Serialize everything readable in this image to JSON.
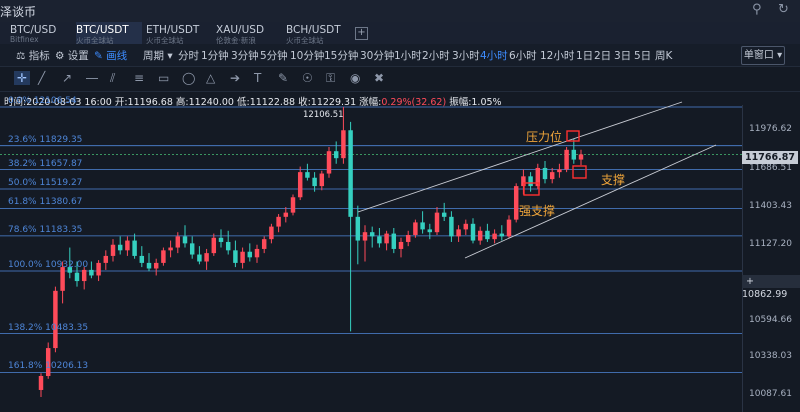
{
  "window": {
    "title": "泽谈币",
    "controls": [
      "search-icon",
      "refresh-icon"
    ]
  },
  "tabs": [
    {
      "name": "BTC/USD",
      "sub": "Bitfinex",
      "active": false
    },
    {
      "name": "BTC/USDT",
      "sub": "火币全球站",
      "active": true
    },
    {
      "name": "ETH/USDT",
      "sub": "火币全球站",
      "active": false
    },
    {
      "name": "XAU/USD",
      "sub": "伦敦金·新浪",
      "active": false
    },
    {
      "name": "BCH/USDT",
      "sub": "火币全球站",
      "active": false
    }
  ],
  "toolbar": {
    "indicator": "指标",
    "settings": "设置",
    "draw": "画线",
    "period": "周期",
    "timeframes": [
      "分时",
      "1分钟",
      "3分钟",
      "5分钟",
      "10分钟",
      "15分钟",
      "30分钟",
      "1小时",
      "2小时",
      "3小时",
      "4小时",
      "6小时",
      "12小时",
      "1日",
      "2日",
      "3日",
      "5日",
      "周K"
    ],
    "active_timeframe": "4小时",
    "new_window": "单窗口"
  },
  "draw_tools": [
    "crosshair-icon",
    "line-icon",
    "ray-icon",
    "horizontal-line-icon",
    "parallel-channel-icon",
    "fibonacci-icon",
    "rectangle-icon",
    "ellipse-icon",
    "triangle-icon",
    "arrow-icon",
    "text-icon",
    "pencil-icon",
    "magnet-icon",
    "lock-icon",
    "eye-icon",
    "trash-icon"
  ],
  "ohlc": {
    "time_label": "时间:",
    "time": "2020-08-03 16:00",
    "open_label": "开:",
    "open": "11196.68",
    "high_label": "高:",
    "high": "11240.00",
    "low_label": "低:",
    "low": "11122.88",
    "close_label": "收:",
    "close": "11229.31",
    "change_label": "涨幅:",
    "change": "0.29%(32.62)",
    "amplitude_label": "振幅:",
    "amplitude": "1.05%"
  },
  "price_axis": [
    "11976.62",
    "11686.51",
    "11403.43",
    "11127.20",
    "10594.66",
    "10338.03",
    "10087.61"
  ],
  "current_price": "11766.87",
  "hover_price": "10862.99",
  "fib_levels": [
    {
      "label": "0.0% 12106.54",
      "price": 12106.54
    },
    {
      "label": "23.6% 11829.35",
      "price": 11829.35
    },
    {
      "label": "38.2% 11657.87",
      "price": 11657.87
    },
    {
      "label": "50.0% 11519.27",
      "price": 11519.27
    },
    {
      "label": "61.8% 11380.67",
      "price": 11380.67
    },
    {
      "label": "78.6% 11183.35",
      "price": 11183.35
    },
    {
      "label": "100.0% 10932.00",
      "price": 10932.0
    },
    {
      "label": "138.2% 10483.35",
      "price": 10483.35
    },
    {
      "label": "161.8% 10206.13",
      "price": 10206.13
    }
  ],
  "peak_label": "12106.51",
  "annotations": {
    "resistance": "压力位",
    "support": "支撑",
    "strong_support": "强支撑"
  },
  "colors": {
    "up": "#ff4b5a",
    "down": "#35d0c0",
    "fib": "#4e86d8",
    "annotation": "#f0a53a",
    "marker": "#ff3030"
  },
  "chart_data": {
    "type": "candlestick",
    "ylim": [
      10030,
      12160
    ],
    "candles": [
      {
        "o": 10080,
        "h": 10200,
        "l": 10030,
        "c": 10180
      },
      {
        "o": 10180,
        "h": 10420,
        "l": 10160,
        "c": 10380
      },
      {
        "o": 10380,
        "h": 10820,
        "l": 10350,
        "c": 10790
      },
      {
        "o": 10790,
        "h": 11000,
        "l": 10700,
        "c": 10960
      },
      {
        "o": 10960,
        "h": 11100,
        "l": 10880,
        "c": 10920
      },
      {
        "o": 10920,
        "h": 11000,
        "l": 10820,
        "c": 10860
      },
      {
        "o": 10860,
        "h": 10960,
        "l": 10800,
        "c": 10940
      },
      {
        "o": 10940,
        "h": 11000,
        "l": 10880,
        "c": 10900
      },
      {
        "o": 10900,
        "h": 11010,
        "l": 10860,
        "c": 10990
      },
      {
        "o": 10990,
        "h": 11080,
        "l": 10940,
        "c": 11040
      },
      {
        "o": 11040,
        "h": 11160,
        "l": 11000,
        "c": 11120
      },
      {
        "o": 11120,
        "h": 11180,
        "l": 11050,
        "c": 11080
      },
      {
        "o": 11080,
        "h": 11180,
        "l": 11040,
        "c": 11150
      },
      {
        "o": 11150,
        "h": 11200,
        "l": 11020,
        "c": 11040
      },
      {
        "o": 11040,
        "h": 11110,
        "l": 10960,
        "c": 10990
      },
      {
        "o": 10990,
        "h": 11060,
        "l": 10930,
        "c": 10950
      },
      {
        "o": 10950,
        "h": 11020,
        "l": 10900,
        "c": 10990
      },
      {
        "o": 10990,
        "h": 11100,
        "l": 10970,
        "c": 11080
      },
      {
        "o": 11080,
        "h": 11150,
        "l": 11030,
        "c": 11100
      },
      {
        "o": 11100,
        "h": 11210,
        "l": 11060,
        "c": 11180
      },
      {
        "o": 11180,
        "h": 11260,
        "l": 11100,
        "c": 11130
      },
      {
        "o": 11130,
        "h": 11180,
        "l": 11020,
        "c": 11050
      },
      {
        "o": 11050,
        "h": 11110,
        "l": 10980,
        "c": 11000
      },
      {
        "o": 11000,
        "h": 11090,
        "l": 10940,
        "c": 11060
      },
      {
        "o": 11060,
        "h": 11200,
        "l": 11040,
        "c": 11170
      },
      {
        "o": 11170,
        "h": 11230,
        "l": 11100,
        "c": 11140
      },
      {
        "o": 11140,
        "h": 11220,
        "l": 11050,
        "c": 11080
      },
      {
        "o": 11080,
        "h": 11150,
        "l": 10960,
        "c": 10990
      },
      {
        "o": 10990,
        "h": 11100,
        "l": 10950,
        "c": 11070
      },
      {
        "o": 11070,
        "h": 11130,
        "l": 11000,
        "c": 11030
      },
      {
        "o": 11030,
        "h": 11120,
        "l": 10990,
        "c": 11090
      },
      {
        "o": 11090,
        "h": 11180,
        "l": 11060,
        "c": 11160
      },
      {
        "o": 11160,
        "h": 11270,
        "l": 11130,
        "c": 11250
      },
      {
        "o": 11250,
        "h": 11340,
        "l": 11210,
        "c": 11320
      },
      {
        "o": 11320,
        "h": 11390,
        "l": 11280,
        "c": 11350
      },
      {
        "o": 11350,
        "h": 11480,
        "l": 11330,
        "c": 11460
      },
      {
        "o": 11460,
        "h": 11680,
        "l": 11440,
        "c": 11640
      },
      {
        "o": 11640,
        "h": 11700,
        "l": 11580,
        "c": 11600
      },
      {
        "o": 11600,
        "h": 11640,
        "l": 11500,
        "c": 11540
      },
      {
        "o": 11540,
        "h": 11650,
        "l": 11510,
        "c": 11630
      },
      {
        "o": 11630,
        "h": 11820,
        "l": 11600,
        "c": 11790
      },
      {
        "o": 11790,
        "h": 11860,
        "l": 11700,
        "c": 11740
      },
      {
        "o": 11740,
        "h": 12106,
        "l": 11700,
        "c": 11940
      },
      {
        "o": 11940,
        "h": 12000,
        "l": 10500,
        "c": 11320
      },
      {
        "o": 11320,
        "h": 11400,
        "l": 10980,
        "c": 11150
      },
      {
        "o": 11150,
        "h": 11260,
        "l": 11000,
        "c": 11210
      },
      {
        "o": 11210,
        "h": 11250,
        "l": 11100,
        "c": 11180
      },
      {
        "o": 11180,
        "h": 11240,
        "l": 11100,
        "c": 11130
      },
      {
        "o": 11130,
        "h": 11220,
        "l": 11080,
        "c": 11200
      },
      {
        "o": 11200,
        "h": 11240,
        "l": 11060,
        "c": 11090
      },
      {
        "o": 11090,
        "h": 11170,
        "l": 11030,
        "c": 11140
      },
      {
        "o": 11140,
        "h": 11220,
        "l": 11110,
        "c": 11190
      },
      {
        "o": 11190,
        "h": 11300,
        "l": 11170,
        "c": 11280
      },
      {
        "o": 11280,
        "h": 11360,
        "l": 11200,
        "c": 11230
      },
      {
        "o": 11230,
        "h": 11270,
        "l": 11160,
        "c": 11210
      },
      {
        "o": 11210,
        "h": 11390,
        "l": 11190,
        "c": 11350
      },
      {
        "o": 11350,
        "h": 11420,
        "l": 11290,
        "c": 11320
      },
      {
        "o": 11320,
        "h": 11360,
        "l": 11140,
        "c": 11180
      },
      {
        "o": 11180,
        "h": 11260,
        "l": 11140,
        "c": 11230
      },
      {
        "o": 11230,
        "h": 11300,
        "l": 11190,
        "c": 11270
      },
      {
        "o": 11270,
        "h": 11310,
        "l": 11130,
        "c": 11150
      },
      {
        "o": 11150,
        "h": 11250,
        "l": 11120,
        "c": 11220
      },
      {
        "o": 11220,
        "h": 11270,
        "l": 11140,
        "c": 11160
      },
      {
        "o": 11160,
        "h": 11230,
        "l": 11130,
        "c": 11200
      },
      {
        "o": 11200,
        "h": 11260,
        "l": 11150,
        "c": 11180
      },
      {
        "o": 11180,
        "h": 11330,
        "l": 11170,
        "c": 11300
      },
      {
        "o": 11300,
        "h": 11560,
        "l": 11280,
        "c": 11540
      },
      {
        "o": 11540,
        "h": 11660,
        "l": 11480,
        "c": 11610
      },
      {
        "o": 11610,
        "h": 11640,
        "l": 11500,
        "c": 11540
      },
      {
        "o": 11540,
        "h": 11700,
        "l": 11520,
        "c": 11670
      },
      {
        "o": 11670,
        "h": 11720,
        "l": 11560,
        "c": 11590
      },
      {
        "o": 11590,
        "h": 11670,
        "l": 11560,
        "c": 11640
      },
      {
        "o": 11640,
        "h": 11700,
        "l": 11600,
        "c": 11660
      },
      {
        "o": 11660,
        "h": 11820,
        "l": 11640,
        "c": 11800
      },
      {
        "o": 11800,
        "h": 11880,
        "l": 11700,
        "c": 11730
      },
      {
        "o": 11730,
        "h": 11800,
        "l": 11690,
        "c": 11767
      }
    ]
  }
}
